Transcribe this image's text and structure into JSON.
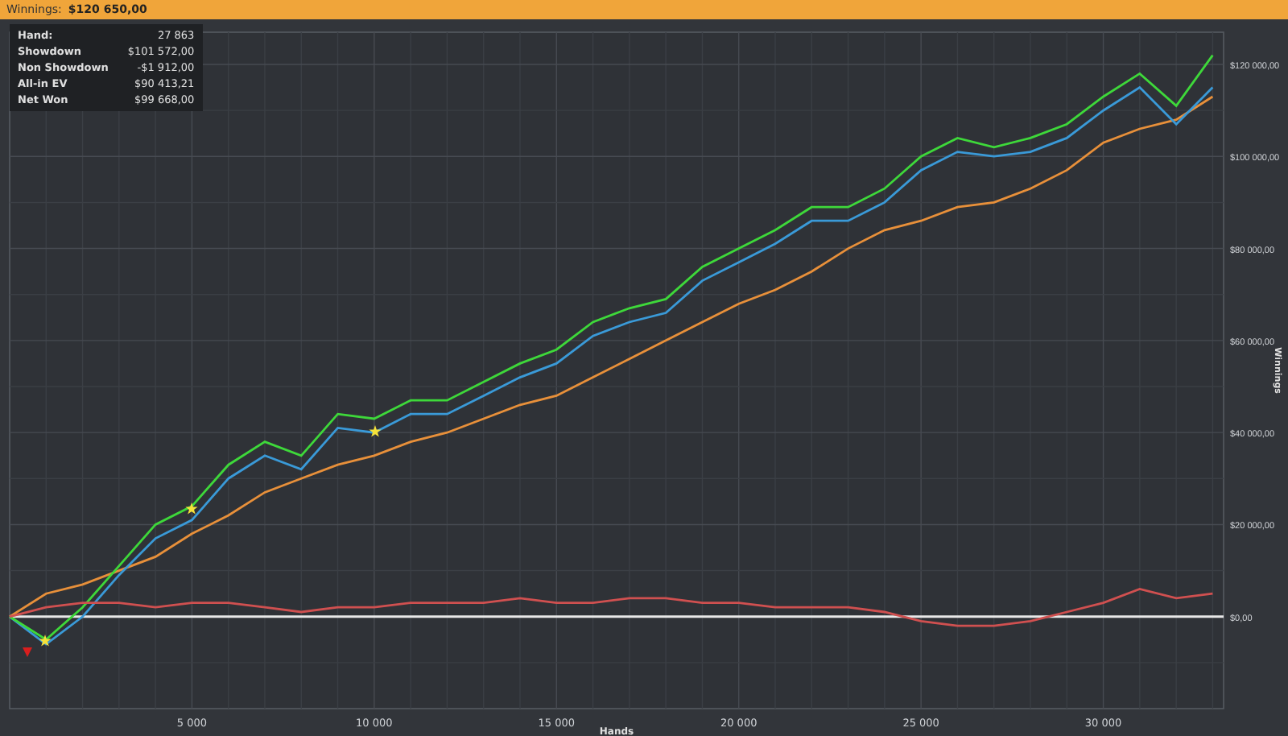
{
  "header": {
    "label": "Winnings:",
    "value": "$120 650,00"
  },
  "stats": [
    {
      "label": "Hand:",
      "value": "27 863"
    },
    {
      "label": "Showdown",
      "value": "$101 572,00"
    },
    {
      "label": "Non Showdown",
      "value": "-$1 912,00"
    },
    {
      "label": "All-in EV",
      "value": "$90 413,21"
    },
    {
      "label": "Net Won",
      "value": "$99 668,00"
    }
  ],
  "chart_data": {
    "type": "line",
    "grid": true,
    "xlabel": "Hands",
    "ylabel": "Winnings",
    "xlim": [
      0,
      33300
    ],
    "ylim": [
      -20000,
      127000
    ],
    "xticks": [
      {
        "value": 5000,
        "label": "5 000"
      },
      {
        "value": 10000,
        "label": "10 000"
      },
      {
        "value": 15000,
        "label": "15 000"
      },
      {
        "value": 20000,
        "label": "20 000"
      },
      {
        "value": 25000,
        "label": "25 000"
      },
      {
        "value": 30000,
        "label": "30 000"
      }
    ],
    "yticks": [
      {
        "value": 0,
        "label": "$0,00"
      },
      {
        "value": 20000,
        "label": "$20 000,00"
      },
      {
        "value": 40000,
        "label": "$40 000,00"
      },
      {
        "value": 60000,
        "label": "$60 000,00"
      },
      {
        "value": 80000,
        "label": "$80 000,00"
      },
      {
        "value": 100000,
        "label": "$100 000,00"
      },
      {
        "value": 120000,
        "label": "$120 000,00"
      }
    ],
    "x": [
      0,
      1000,
      2000,
      3000,
      4000,
      5000,
      6000,
      7000,
      8000,
      9000,
      10000,
      11000,
      12000,
      13000,
      14000,
      15000,
      16000,
      17000,
      18000,
      19000,
      20000,
      21000,
      22000,
      23000,
      24000,
      25000,
      26000,
      27000,
      28000,
      29000,
      30000,
      31000,
      32000,
      33000
    ],
    "series": [
      {
        "color": "#e8903a",
        "values": [
          0,
          5000,
          7000,
          10000,
          13000,
          18000,
          22000,
          27000,
          30000,
          33000,
          35000,
          38000,
          40000,
          43000,
          46000,
          48000,
          52000,
          56000,
          60000,
          64000,
          68000,
          71000,
          75000,
          80000,
          84000,
          86000,
          89000,
          90000,
          93000,
          97000,
          103000,
          106000,
          108000,
          113000
        ]
      },
      {
        "color": "#3a9ad8",
        "values": [
          0,
          -6000,
          0,
          9000,
          17000,
          21000,
          30000,
          35000,
          32000,
          41000,
          40000,
          44000,
          44000,
          48000,
          52000,
          55000,
          61000,
          64000,
          66000,
          73000,
          77000,
          81000,
          86000,
          86000,
          90000,
          97000,
          101000,
          100000,
          101000,
          104000,
          110000,
          115000,
          107000,
          115000
        ]
      },
      {
        "color": "#3ed83a",
        "values": [
          0,
          -5000,
          2000,
          11000,
          20000,
          24000,
          33000,
          38000,
          35000,
          44000,
          43000,
          47000,
          47000,
          51000,
          55000,
          58000,
          64000,
          67000,
          69000,
          76000,
          80000,
          84000,
          89000,
          89000,
          93000,
          100000,
          104000,
          102000,
          104000,
          107000,
          113000,
          118000,
          111000,
          122000
        ]
      },
      {
        "color": "#d05050",
        "values": [
          0,
          2000,
          3000,
          3000,
          2000,
          3000,
          3000,
          2000,
          1000,
          2000,
          2000,
          3000,
          3000,
          3000,
          4000,
          3000,
          3000,
          4000,
          4000,
          3000,
          3000,
          2000,
          2000,
          2000,
          1000,
          -1000,
          -2000,
          -2000,
          -1000,
          1000,
          3000,
          6000,
          4000,
          5000
        ]
      }
    ]
  }
}
